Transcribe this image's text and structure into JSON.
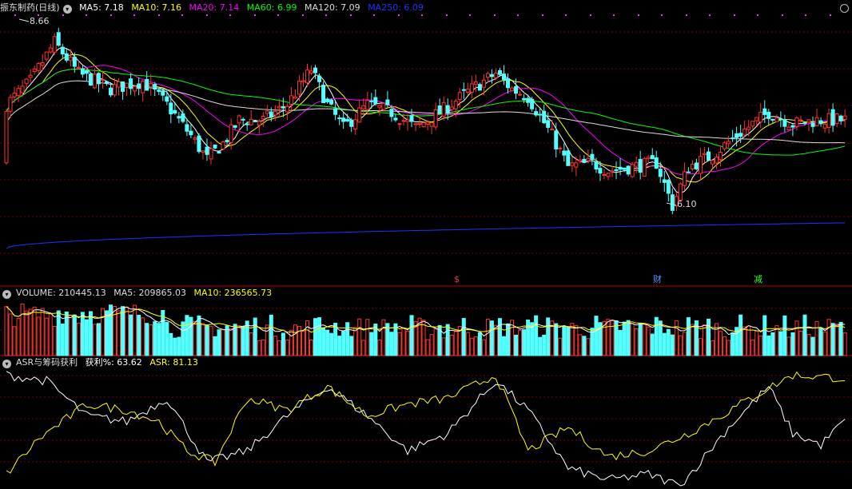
{
  "chart_data": [
    {
      "type": "candlestick",
      "title": "振东制药(日线)",
      "panel": "price",
      "legend": [
        {
          "label": "MA5: 7.18",
          "color": "#ffffff"
        },
        {
          "label": "MA10: 7.16",
          "color": "#ffff00"
        },
        {
          "label": "MA20: 7.14",
          "color": "#ff00ff"
        },
        {
          "label": "MA60: 6.99",
          "color": "#00ff00"
        },
        {
          "label": "MA120: 7.09",
          "color": "#dddddd"
        },
        {
          "label": "MA250: 6.09",
          "color": "#0000ff"
        }
      ],
      "annotations": {
        "high_label": "8.66",
        "low_label": "6.10"
      },
      "event_markers": [
        {
          "text": "$",
          "color": "#ff3333"
        },
        {
          "text": "财",
          "color": "#5599ff"
        },
        {
          "text": "减",
          "color": "#33ff33"
        }
      ],
      "ylim": [
        5.4,
        8.8
      ],
      "grid": true
    },
    {
      "type": "bar",
      "panel": "volume",
      "legend": [
        {
          "label": "VOLUME: 210445.13",
          "color": "#dddddd"
        },
        {
          "label": "MA5: 209865.03",
          "color": "#dddddd"
        },
        {
          "label": "MA10: 236565.73",
          "color": "#ffff00"
        }
      ],
      "values": {
        "volume": 210445.13,
        "ma5": 209865.03,
        "ma10": 236565.73
      }
    },
    {
      "type": "line",
      "panel": "indicator",
      "legend": [
        {
          "label": "ASR与筹码获利",
          "color": "#dddddd"
        },
        {
          "label": "获利%: 63.62",
          "color": "#ffffff"
        },
        {
          "label": "ASR: 81.13",
          "color": "#ffff00"
        }
      ],
      "series": [
        {
          "name": "获利%",
          "color": "#ffffff",
          "last": 63.62
        },
        {
          "name": "ASR",
          "color": "#ffff00",
          "last": 81.13
        }
      ]
    }
  ],
  "colors": {
    "up": "#ff3232",
    "down": "#54ffff",
    "grid": "#7a0000",
    "divider": "#c00000"
  }
}
